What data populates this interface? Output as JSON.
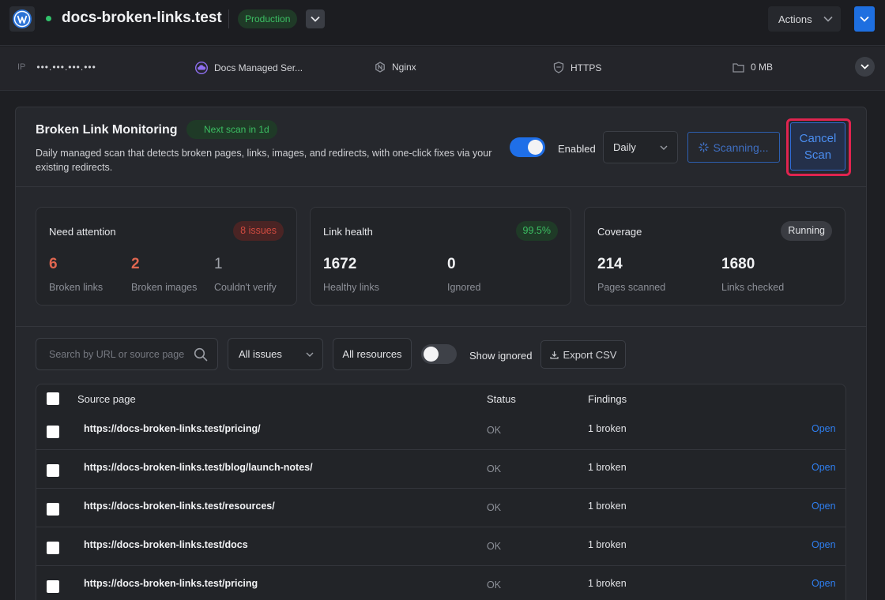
{
  "header": {
    "site_name": "docs-broken-links.test",
    "environment": "Production",
    "actions_label": "Actions"
  },
  "info": {
    "ip_label": "IP",
    "ip_value": "•••.•••.•••.•••",
    "host": "Docs Managed Ser...",
    "server": "Nginx",
    "protocol": "HTTPS",
    "storage": "0 MB"
  },
  "monitor": {
    "title": "Broken Link Monitoring",
    "next_scan": "Next scan in 1d",
    "description": "Daily managed scan that detects broken pages, links, images, and redirects, with one-click fixes via your existing redirects.",
    "enabled_label": "Enabled",
    "enabled": true,
    "frequency": "Daily",
    "scanning_label": "Scanning...",
    "cancel_line1": "Cancel",
    "cancel_line2": "Scan"
  },
  "stats": {
    "attention": {
      "title": "Need attention",
      "badge": "8 issues",
      "metrics": [
        {
          "value": "6",
          "label": "Broken links"
        },
        {
          "value": "2",
          "label": "Broken images"
        },
        {
          "value": "1",
          "label": "Couldn't verify"
        }
      ]
    },
    "health": {
      "title": "Link health",
      "badge": "99.5%",
      "metrics": [
        {
          "value": "1672",
          "label": "Healthy links"
        },
        {
          "value": "0",
          "label": "Ignored"
        }
      ]
    },
    "coverage": {
      "title": "Coverage",
      "badge": "Running",
      "metrics": [
        {
          "value": "214",
          "label": "Pages scanned"
        },
        {
          "value": "1680",
          "label": "Links checked"
        }
      ]
    }
  },
  "filters": {
    "search_placeholder": "Search by URL or source page",
    "issue_filter": "All issues",
    "resource_filter": "All resources",
    "show_ignored_label": "Show ignored",
    "show_ignored": false,
    "export_label": "Export CSV"
  },
  "table": {
    "columns": [
      "Source page",
      "Status",
      "Findings"
    ],
    "rows": [
      {
        "url": "https://docs-broken-links.test/pricing/",
        "status": "OK",
        "findings": "1 broken",
        "action": "Open"
      },
      {
        "url": "https://docs-broken-links.test/blog/launch-notes/",
        "status": "OK",
        "findings": "1 broken",
        "action": "Open"
      },
      {
        "url": "https://docs-broken-links.test/resources/",
        "status": "OK",
        "findings": "1 broken",
        "action": "Open"
      },
      {
        "url": "https://docs-broken-links.test/docs",
        "status": "OK",
        "findings": "1 broken",
        "action": "Open"
      },
      {
        "url": "https://docs-broken-links.test/pricing",
        "status": "OK",
        "findings": "1 broken",
        "action": "Open"
      }
    ]
  }
}
